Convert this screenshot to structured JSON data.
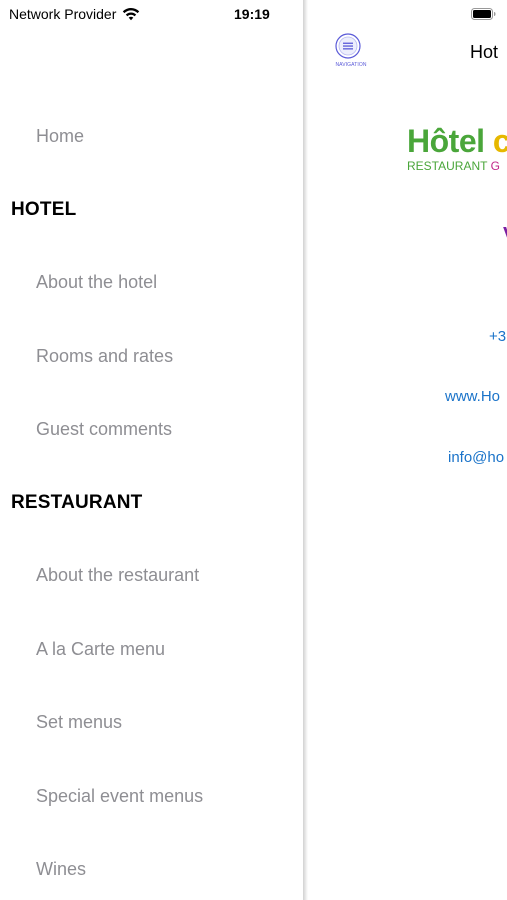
{
  "status_bar": {
    "carrier": "Network Provider",
    "time": "19:19"
  },
  "drawer": {
    "home": "Home",
    "sections": [
      {
        "title": "HOTEL",
        "items": [
          "About the hotel",
          "Rooms and rates",
          "Guest comments"
        ]
      },
      {
        "title": "RESTAURANT",
        "items": [
          "About the restaurant",
          "A la Carte menu",
          "Set menus",
          "Special event menus",
          "Wines"
        ]
      }
    ]
  },
  "main": {
    "nav_button_caption": "NAVIGATION",
    "title": "Hot",
    "logo": {
      "line1_main": "Hôtel",
      "line1_accent": "c",
      "line2_main": "RESTAURANT",
      "line2_accent": "G"
    },
    "partial_heading": "V",
    "phone": "+3",
    "website": "www.Ho",
    "email": "info@ho"
  },
  "colors": {
    "menu_text": "#8e8e93",
    "section_header": "#000000",
    "link": "#1a73c9",
    "logo_green": "#4aa63a",
    "logo_yellow": "#e6b800",
    "logo_magenta": "#c2288a",
    "purple": "#7b1fa2",
    "nav_icon": "#5a5ad8"
  },
  "icons": [
    "wifi-icon",
    "battery-icon",
    "navigation-menu-icon"
  ]
}
